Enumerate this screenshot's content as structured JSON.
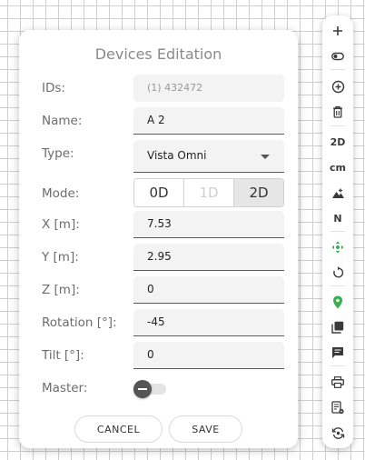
{
  "dialog": {
    "title": "Devices Editation",
    "fields": {
      "ids": {
        "label": "IDs:",
        "value": "(1) 432472"
      },
      "name": {
        "label": "Name:",
        "value": "A 2"
      },
      "type": {
        "label": "Type:",
        "value": "Vista Omni"
      },
      "mode": {
        "label": "Mode:",
        "options": [
          "0D",
          "1D",
          "2D"
        ],
        "selected": "2D"
      },
      "x": {
        "label": "X [m]:",
        "value": "7.53"
      },
      "y": {
        "label": "Y [m]:",
        "value": "2.95"
      },
      "z": {
        "label": "Z [m]:",
        "value": "0"
      },
      "rotation": {
        "label": "Rotation [°]:",
        "value": "-45"
      },
      "tilt": {
        "label": "Tilt [°]:",
        "value": "0"
      },
      "master": {
        "label": "Master:",
        "checked": false
      }
    },
    "buttons": {
      "cancel": "CANCEL",
      "save": "SAVE"
    }
  },
  "toolbar": {
    "items": [
      {
        "icon": "plus-icon"
      },
      {
        "icon": "toggle-icon"
      },
      {
        "icon": "add-circle-icon"
      },
      {
        "icon": "trash-icon"
      },
      {
        "label": "2D"
      },
      {
        "label": "cm"
      },
      {
        "icon": "terrain-icon"
      },
      {
        "label": "N"
      },
      {
        "icon": "move-arrows-icon",
        "color": "#3cae52"
      },
      {
        "icon": "rotate-icon"
      },
      {
        "icon": "location-pin-icon",
        "color": "#3cae52"
      },
      {
        "icon": "layers-icon"
      },
      {
        "icon": "comment-icon"
      },
      {
        "icon": "print-icon"
      },
      {
        "icon": "settings-list-icon"
      },
      {
        "icon": "sync-icon"
      }
    ]
  }
}
